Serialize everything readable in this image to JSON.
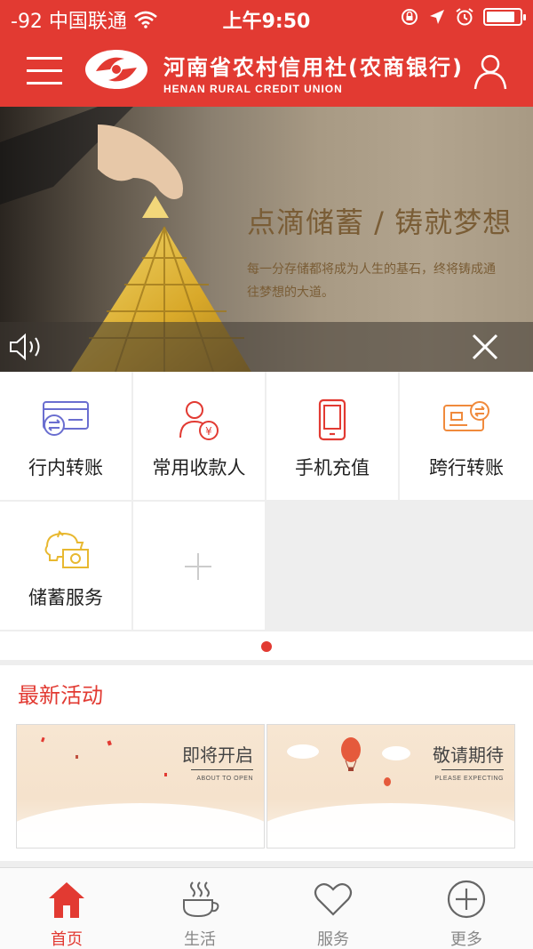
{
  "status_bar": {
    "carrier": "-92 中国联通",
    "time": "上午9:50",
    "battery_level": 0.85
  },
  "header": {
    "brand_cn": "河南省农村信用社(农商银行)",
    "brand_en": "HENAN RURAL CREDIT UNION",
    "menu_icon": "hamburger-menu-icon",
    "user_icon": "user-icon"
  },
  "banner": {
    "slogan": "点滴储蓄 / 铸就梦想",
    "description": "每一分存储都将成为人生的基石，终将铸成通往梦想的大道。",
    "speaker_icon": "speaker-icon",
    "close_icon": "close-icon"
  },
  "services": [
    {
      "label": "行内转账",
      "icon": "card-transfer-icon"
    },
    {
      "label": "常用收款人",
      "icon": "payee-icon"
    },
    {
      "label": "手机充值",
      "icon": "phone-icon"
    },
    {
      "label": "跨行转账",
      "icon": "interbank-transfer-icon"
    },
    {
      "label": "储蓄服务",
      "icon": "piggy-bank-icon"
    }
  ],
  "activity": {
    "title": "最新活动",
    "cards": [
      {
        "title": "即将开启",
        "subtitle": "ABOUT TO OPEN"
      },
      {
        "title": "敬请期待",
        "subtitle": "PLEASE EXPECTING"
      }
    ]
  },
  "tabs": [
    {
      "label": "首页",
      "icon": "home-icon",
      "active": true
    },
    {
      "label": "生活",
      "icon": "coffee-cup-icon",
      "active": false
    },
    {
      "label": "服务",
      "icon": "heart-icon",
      "active": false
    },
    {
      "label": "更多",
      "icon": "plus-circle-icon",
      "active": false
    }
  ],
  "colors": {
    "brand_red": "#e23a32",
    "banner_text": "#7a5d36",
    "icon_purple": "#6a6ed0",
    "icon_orange": "#f08a3c",
    "icon_yellow": "#e8b830"
  }
}
